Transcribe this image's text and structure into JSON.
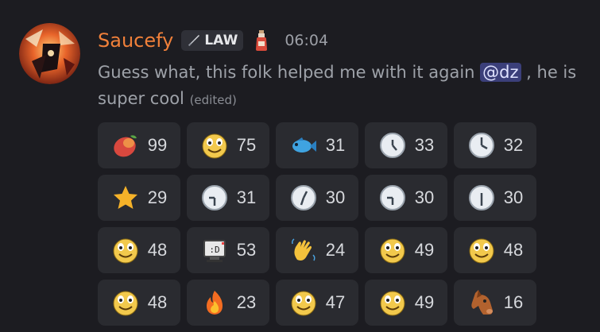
{
  "message": {
    "username": "Saucefy",
    "tag": "LAW",
    "timestamp": "06:04",
    "text_before": "Guess what, this folk helped me with it again ",
    "mention": "@dz",
    "text_after": " , he is super cool ",
    "edited": "(edited)"
  },
  "icons": {
    "avatar": "avatar-image",
    "tag_icon": "sword-icon",
    "badge": "potion-bottle-icon"
  },
  "colors": {
    "username": "#f0803a",
    "mention_bg": "#3b3f7a",
    "reaction_bg": "#2a2b30"
  },
  "reactions": [
    [
      {
        "emoji": "mango-icon",
        "count": "99"
      },
      {
        "emoji": "smiley-face-icon",
        "count": "75"
      },
      {
        "emoji": "fish-icon",
        "count": "31"
      },
      {
        "emoji": "clock-icon",
        "count": "33"
      },
      {
        "emoji": "clock-icon",
        "count": "32"
      }
    ],
    [
      {
        "emoji": "star-icon",
        "count": "29"
      },
      {
        "emoji": "clock-icon",
        "count": "31"
      },
      {
        "emoji": "clock-icon",
        "count": "30"
      },
      {
        "emoji": "clock-icon",
        "count": "30"
      },
      {
        "emoji": "clock-icon",
        "count": "30"
      }
    ],
    [
      {
        "emoji": "smiley-face-icon",
        "count": "48"
      },
      {
        "emoji": "computer-face-icon",
        "count": "53"
      },
      {
        "emoji": "waving-hand-icon",
        "count": "24"
      },
      {
        "emoji": "smiley-face-icon",
        "count": "49"
      },
      {
        "emoji": "smiley-face-icon",
        "count": "48"
      }
    ],
    [
      {
        "emoji": "smiley-face-icon",
        "count": "48"
      },
      {
        "emoji": "fire-icon",
        "count": "23"
      },
      {
        "emoji": "smiley-face-icon",
        "count": "47"
      },
      {
        "emoji": "smiley-face-icon",
        "count": "49"
      },
      {
        "emoji": "horse-face-icon",
        "count": "16"
      }
    ]
  ]
}
